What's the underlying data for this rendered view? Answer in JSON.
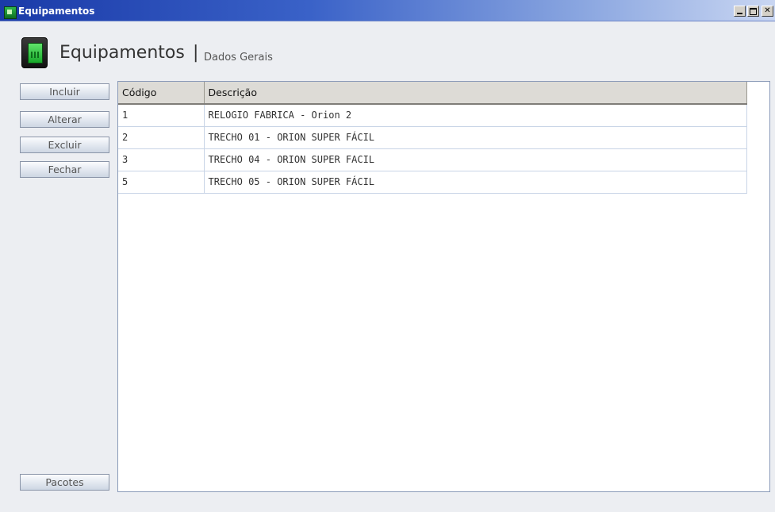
{
  "window": {
    "title": "Equipamentos",
    "controls": {
      "minimize": "_",
      "maximize": "□",
      "close": "✕"
    }
  },
  "header": {
    "title": "Equipamentos",
    "separator": "|",
    "subtitle": "Dados Gerais"
  },
  "actions": {
    "incluir": "Incluir",
    "alterar": "Alterar",
    "excluir": "Excluir",
    "fechar": "Fechar",
    "pacotes": "Pacotes"
  },
  "table": {
    "columns": [
      "Código",
      "Descrição"
    ],
    "rows": [
      {
        "codigo": "1",
        "descricao": "RELOGIO FABRICA - Orion 2"
      },
      {
        "codigo": "2",
        "descricao": "TRECHO 01 - ORION SUPER FÁCIL"
      },
      {
        "codigo": "3",
        "descricao": "TRECHO 04 - ORION SUPER FACIL"
      },
      {
        "codigo": "5",
        "descricao": "TRECHO 05 - ORION SUPER FÁCIL"
      }
    ]
  },
  "colors": {
    "titlebar_start": "#1a3aa8",
    "background": "#eceef2",
    "grid_border": "#8a9ab8"
  }
}
